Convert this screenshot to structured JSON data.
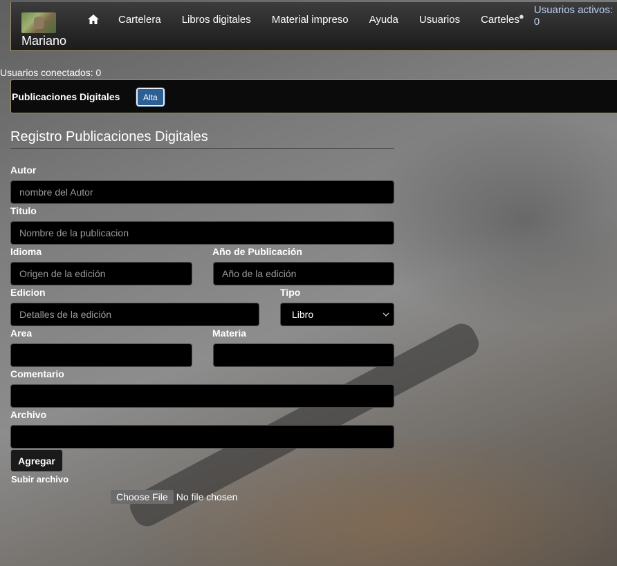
{
  "header": {
    "brand_name": "Mariano",
    "nav_items": [
      {
        "label": "Cartelera"
      },
      {
        "label": "Libros digitales"
      },
      {
        "label": "Material impreso"
      },
      {
        "label": "Ayuda"
      },
      {
        "label": "Usuarios"
      },
      {
        "label": "Carteles"
      }
    ],
    "active_users": "Usuarios activos: 0"
  },
  "connected_users": "Usuarios conectados: 0",
  "subnav": {
    "title": "Publicaciones Digitales",
    "alta_label": "Alta"
  },
  "form": {
    "title": "Registro Publicaciones Digitales",
    "autor": {
      "label": "Autor",
      "placeholder": "nombre del Autor"
    },
    "titulo": {
      "label": "Titulo",
      "placeholder": "Nombre de la publicacion"
    },
    "idioma": {
      "label": "Idioma",
      "placeholder": "Origen de la edición"
    },
    "anio": {
      "label": "Año de Publicación",
      "placeholder": "Año de la edición"
    },
    "edicion": {
      "label": "Edicion",
      "placeholder": "Detalles de la edición"
    },
    "tipo": {
      "label": "Tipo",
      "value": "Libro"
    },
    "area": {
      "label": "Area",
      "placeholder": ""
    },
    "materia": {
      "label": "Materia",
      "placeholder": ""
    },
    "comentario": {
      "label": "Comentario",
      "placeholder": ""
    },
    "archivo": {
      "label": "Archivo",
      "placeholder": ""
    },
    "submit_label": "Agregar",
    "upload_label": "Subir archivo",
    "choose_file_label": "Choose File",
    "file_status": "No file chosen"
  },
  "colors": {
    "alta_button": "#2e5f93",
    "active_users_text": "#bcd2f0",
    "input_background": "#000000"
  },
  "icons": {
    "home": "home-icon",
    "select_arrow": "chevron-down-icon"
  }
}
